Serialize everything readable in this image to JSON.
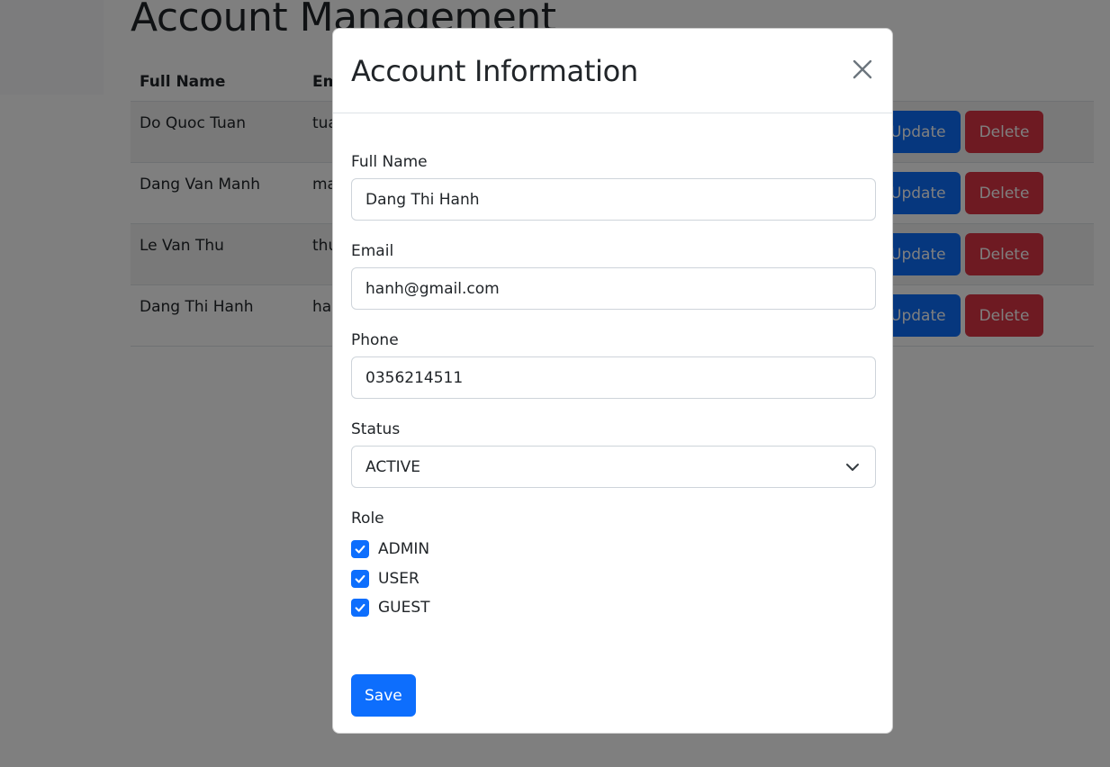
{
  "page": {
    "title": "Account Management"
  },
  "table": {
    "headers": {
      "full_name": "Full Name",
      "email": "Em"
    },
    "rows": [
      {
        "full_name": "Do Quoc Tuan",
        "email": "tua",
        "update_label": "Update",
        "delete_label": "Delete"
      },
      {
        "full_name": "Dang Van Manh",
        "email": "ma",
        "update_label": "Update",
        "delete_label": "Delete"
      },
      {
        "full_name": "Le Van Thu",
        "email": "thu",
        "update_label": "Update",
        "delete_label": "Delete"
      },
      {
        "full_name": "Dang Thi Hanh",
        "email": "ha",
        "update_label": "Update",
        "delete_label": "Delete"
      }
    ]
  },
  "modal": {
    "title": "Account Information",
    "fields": {
      "full_name": {
        "label": "Full Name",
        "value": "Dang Thi Hanh"
      },
      "email": {
        "label": "Email",
        "value": "hanh@gmail.com"
      },
      "phone": {
        "label": "Phone",
        "value": "0356214511"
      },
      "status": {
        "label": "Status",
        "value": "ACTIVE"
      }
    },
    "role": {
      "label": "Role",
      "options": [
        {
          "label": "ADMIN",
          "checked": true
        },
        {
          "label": "USER",
          "checked": true
        },
        {
          "label": "GUEST",
          "checked": true
        }
      ]
    },
    "save_label": "Save"
  },
  "colors": {
    "primary": "#0d6efd",
    "danger": "#dc3545",
    "backdrop": "rgba(0,0,0,0.5)"
  },
  "icons": {
    "close": "close-icon",
    "select": "chevron-down-icon",
    "check": "check-icon"
  }
}
